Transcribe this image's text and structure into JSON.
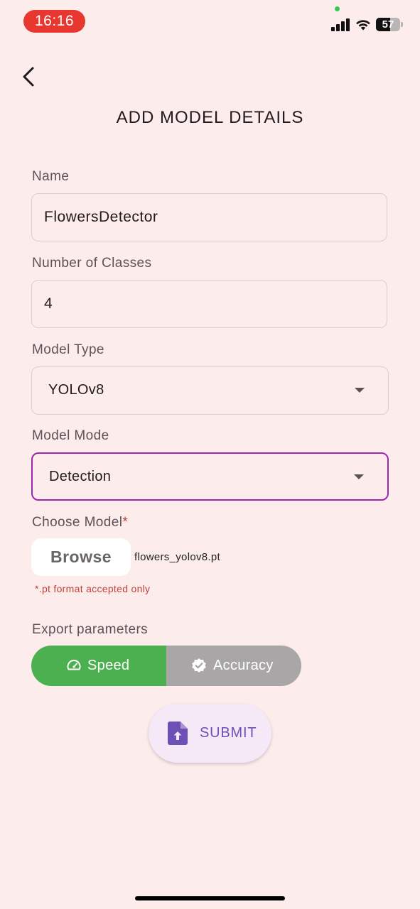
{
  "status_bar": {
    "time": "16:16",
    "battery": "57"
  },
  "header": {
    "title": "ADD MODEL DETAILS"
  },
  "form": {
    "name": {
      "label": "Name",
      "value": "FlowersDetector"
    },
    "num_classes": {
      "label": "Number of Classes",
      "value": "4"
    },
    "model_type": {
      "label": "Model Type",
      "value": "YOLOv8"
    },
    "model_mode": {
      "label": "Model Mode",
      "value": "Detection"
    },
    "choose_model": {
      "label": "Choose Model",
      "required_mark": "*",
      "browse_label": "Browse",
      "file_name": "flowers_yolov8.pt",
      "hint": "*.pt format accepted only"
    },
    "export": {
      "label": "Export parameters",
      "options": [
        {
          "label": "Speed",
          "icon": "speedometer-icon",
          "selected": true
        },
        {
          "label": "Accuracy",
          "icon": "verified-check-icon",
          "selected": false
        }
      ]
    },
    "submit_label": "SUBMIT"
  },
  "colors": {
    "background": "#fcecec",
    "focus_border": "#9c27b0",
    "selected_segment": "#4caf50",
    "unselected_segment": "#a9a6a7",
    "submit_text": "#6e4fb5",
    "error_text": "#c2413b"
  }
}
